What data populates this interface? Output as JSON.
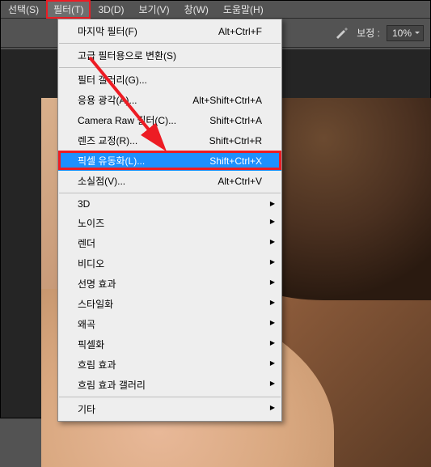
{
  "menubar": {
    "select": "선택(S)",
    "filter": "필터(T)",
    "threeD": "3D(D)",
    "view": "보기(V)",
    "window": "창(W)",
    "help": "도움말(H)"
  },
  "toolbar": {
    "correct_label": "보정 :",
    "correct_value": "10%"
  },
  "filter_menu": {
    "last": {
      "label": "마지막 필터(F)",
      "shortcut": "Alt+Ctrl+F"
    },
    "convert_smart": {
      "label": "고급 필터용으로 변환(S)"
    },
    "gallery": {
      "label": "필터 갤러리(G)..."
    },
    "adaptive": {
      "label": "응용 광각(A)...",
      "shortcut": "Alt+Shift+Ctrl+A"
    },
    "camera_raw": {
      "label": "Camera Raw 필터(C)...",
      "shortcut": "Shift+Ctrl+A"
    },
    "lens": {
      "label": "렌즈 교정(R)...",
      "shortcut": "Shift+Ctrl+R"
    },
    "liquify": {
      "label": "픽셀 유동화(L)...",
      "shortcut": "Shift+Ctrl+X"
    },
    "vanishing": {
      "label": "소실점(V)...",
      "shortcut": "Alt+Ctrl+V"
    },
    "threeD": {
      "label": "3D"
    },
    "noise": {
      "label": "노이즈"
    },
    "render": {
      "label": "렌더"
    },
    "video": {
      "label": "비디오"
    },
    "sharpen": {
      "label": "선명 효과"
    },
    "stylize": {
      "label": "스타일화"
    },
    "distort": {
      "label": "왜곡"
    },
    "pixelate": {
      "label": "픽셀화"
    },
    "blur": {
      "label": "흐림 효과"
    },
    "blur_gallery": {
      "label": "흐림 효과 갤러리"
    },
    "other": {
      "label": "기타"
    }
  }
}
